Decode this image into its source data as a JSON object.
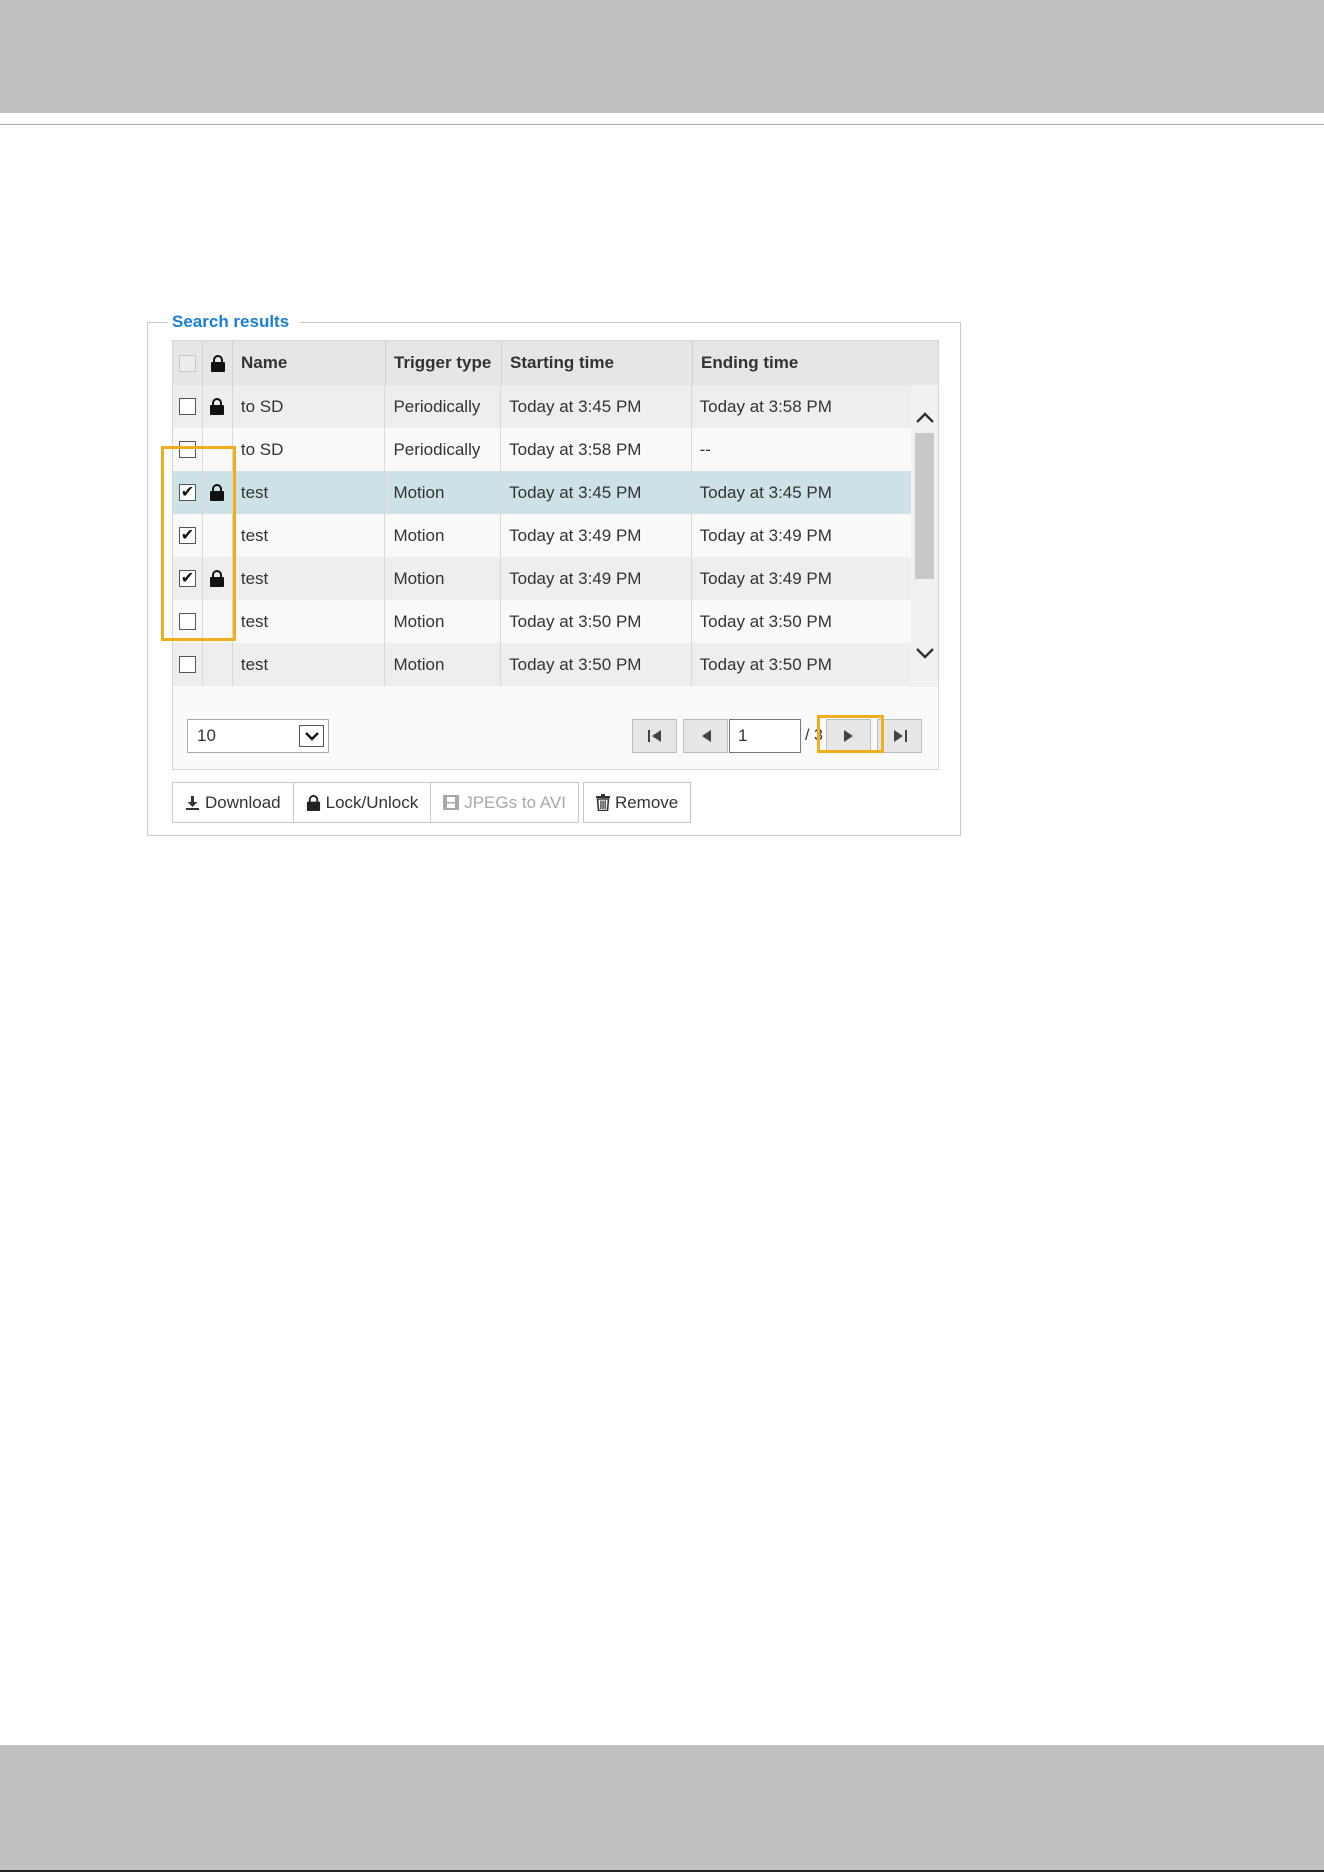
{
  "panel": {
    "legend": "Search results"
  },
  "table": {
    "headers": {
      "name": "Name",
      "trigger_type": "Trigger type",
      "starting_time": "Starting time",
      "ending_time": "Ending time"
    },
    "rows": [
      {
        "checked": false,
        "locked": true,
        "name": "to SD",
        "trigger_type": "Periodically",
        "starting_time": "Today at 3:45 PM",
        "ending_time": "Today at 3:58 PM",
        "selected": false
      },
      {
        "checked": false,
        "locked": false,
        "name": "to SD",
        "trigger_type": "Periodically",
        "starting_time": "Today at 3:58 PM",
        "ending_time": "--",
        "selected": false
      },
      {
        "checked": true,
        "locked": true,
        "name": "test",
        "trigger_type": "Motion",
        "starting_time": "Today at 3:45 PM",
        "ending_time": "Today at 3:45 PM",
        "selected": true
      },
      {
        "checked": true,
        "locked": false,
        "name": "test",
        "trigger_type": "Motion",
        "starting_time": "Today at 3:49 PM",
        "ending_time": "Today at 3:49 PM",
        "selected": false
      },
      {
        "checked": true,
        "locked": true,
        "name": "test",
        "trigger_type": "Motion",
        "starting_time": "Today at 3:49 PM",
        "ending_time": "Today at 3:49 PM",
        "selected": false
      },
      {
        "checked": false,
        "locked": false,
        "name": "test",
        "trigger_type": "Motion",
        "starting_time": "Today at 3:50 PM",
        "ending_time": "Today at 3:50 PM",
        "selected": false
      },
      {
        "checked": false,
        "locked": false,
        "name": "test",
        "trigger_type": "Motion",
        "starting_time": "Today at 3:50 PM",
        "ending_time": "Today at 3:50 PM",
        "selected": false
      }
    ]
  },
  "pager": {
    "per_page": "10",
    "current_page": "1",
    "separator": "/",
    "total_pages": "3"
  },
  "actions": {
    "download": "Download",
    "lock_unlock": "Lock/Unlock",
    "jpegs_to_avi": "JPEGs to AVI",
    "remove": "Remove"
  },
  "colors": {
    "legend": "#1a7fd4",
    "highlight": "#f2ad1c",
    "selected_row": "#cce2e7"
  }
}
